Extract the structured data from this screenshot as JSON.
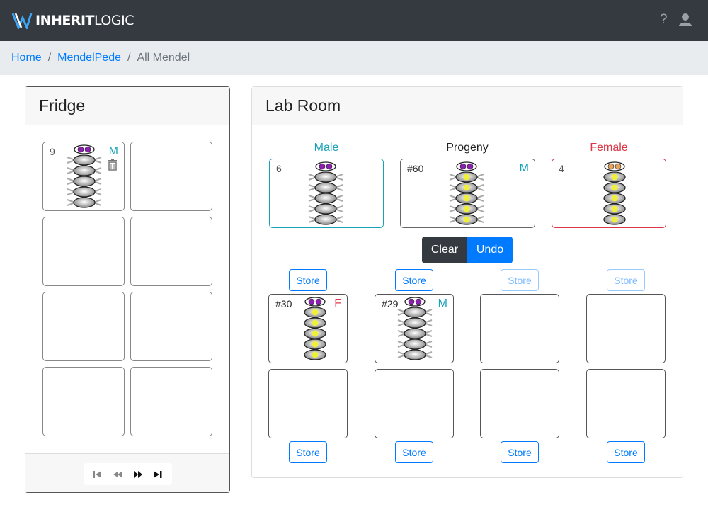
{
  "header": {
    "logo_bold": "INHERIT",
    "logo_light": "LOGIC",
    "help_label": "?",
    "icons": [
      "logo-icon",
      "help-icon",
      "user-icon"
    ]
  },
  "breadcrumb": {
    "home": "Home",
    "section": "MendelPede",
    "current": "All Mendel"
  },
  "fridge": {
    "title": "Fridge",
    "slots": [
      {
        "number": "9",
        "sex": "M",
        "eyes": "purple",
        "body": "white",
        "legs": true,
        "trash_icon": "trash-icon"
      }
    ],
    "pager_icons": [
      "first-page-icon",
      "prev-page-icon",
      "next-page-icon",
      "last-page-icon"
    ]
  },
  "lab": {
    "title": "Lab Room",
    "parents": {
      "male": {
        "label": "Male",
        "number": "6",
        "eyes": "purple",
        "body": "white",
        "legs": true
      },
      "progeny": {
        "label": "Progeny",
        "number": "#60",
        "sex": "M",
        "eyes": "purple",
        "body": "yellow",
        "legs": true
      },
      "female": {
        "label": "Female",
        "number": "4",
        "eyes": "orange",
        "body": "yellow",
        "legs": false
      }
    },
    "clear_label": "Clear",
    "undo_label": "Undo",
    "store_label": "Store",
    "offspring": [
      {
        "number": "#30",
        "sex": "F",
        "eyes": "purple",
        "body": "yellow",
        "legs": false
      },
      {
        "number": "#29",
        "sex": "M",
        "eyes": "purple",
        "body": "white",
        "legs": true
      }
    ]
  },
  "colors": {
    "male": "#17a2b8",
    "female": "#dc3545",
    "primary": "#007bff",
    "dark": "#343a40",
    "eye_purple": "#8a1fb0",
    "eye_orange": "#e3a35b",
    "body_yellow": "#eef03a"
  }
}
